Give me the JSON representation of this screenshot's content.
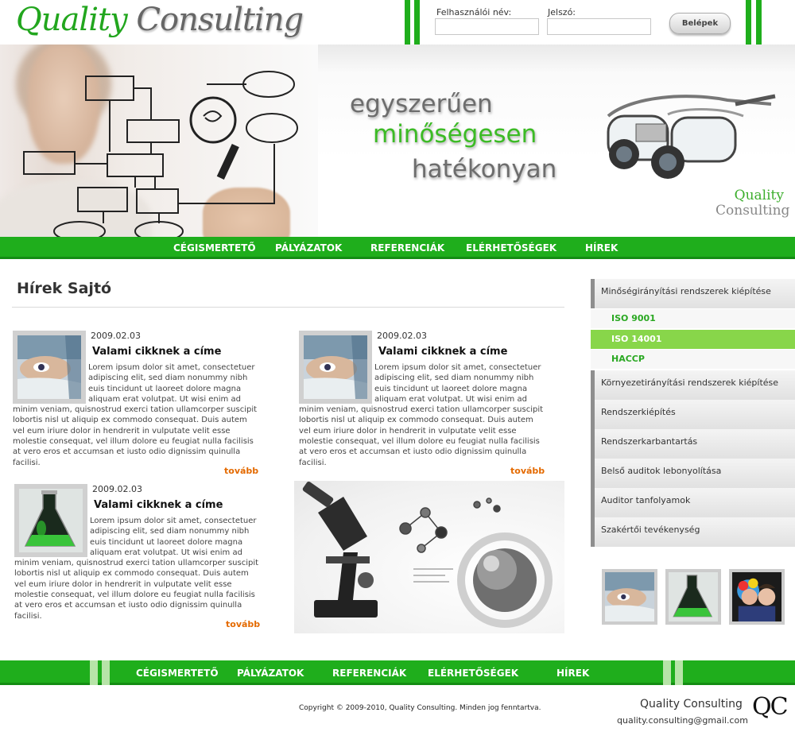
{
  "brand": {
    "word1": "Quality",
    "word2": "Consulting"
  },
  "login": {
    "username_label": "Felhasználói név:",
    "password_label": "Jelszó:",
    "username_value": "",
    "password_value": "",
    "button_label": "Belépek"
  },
  "banner": {
    "slogan_1": "egyszerűen",
    "slogan_2": "minőségesen",
    "slogan_3": "hatékonyan",
    "brand_1": "Quality",
    "brand_2": "Consulting"
  },
  "nav": {
    "items": [
      "CÉGISMERTETŐ",
      "PÁLYÁZATOK",
      "REFERENCIÁK",
      "ELÉRHETŐSÉGEK",
      "HÍREK"
    ]
  },
  "main": {
    "title": "Hírek Sajtó",
    "articles": [
      {
        "date": "2009.02.03",
        "title": "Valami cikknek a címe",
        "body": "Lorem ipsum dolor sit amet, consectetuer adipiscing elit, sed diam nonummy nibh euis tincidunt ut laoreet dolore magna aliquam erat volutpat. Ut wisi enim ad minim veniam, quisnostrud exerci tation ullamcorper suscipit lobortis nisl ut aliquip ex commodo consequat. Duis autem vel eum iriure dolor in hendrerit in vulputate velit esse molestie consequat, vel illum dolore eu feugiat nulla facilisis at vero eros et accumsan et iusto odio dignissim quinulla facilisi.",
        "more": "tovább",
        "image": "surgeon-photo"
      },
      {
        "date": "2009.02.03",
        "title": "Valami cikknek a címe",
        "body": "Lorem ipsum dolor sit amet, consectetuer adipiscing elit, sed diam nonummy nibh euis tincidunt ut laoreet dolore magna aliquam erat volutpat. Ut wisi enim ad minim veniam, quisnostrud exerci tation ullamcorper suscipit lobortis nisl ut aliquip ex commodo consequat. Duis autem vel eum iriure dolor in hendrerit in vulputate velit esse molestie consequat, vel illum dolore eu feugiat nulla facilisis at vero eros et accumsan et iusto odio dignissim quinulla facilisi.",
        "more": "tovább",
        "image": "surgeon-photo"
      },
      {
        "date": "2009.02.03",
        "title": "Valami cikknek a címe",
        "body": "Lorem ipsum dolor sit amet, consectetuer adipiscing elit, sed diam nonummy nibh euis tincidunt ut laoreet dolore magna aliquam erat volutpat. Ut wisi enim ad minim veniam, quisnostrud exerci tation ullamcorper suscipit lobortis nisl ut aliquip ex commodo consequat. Duis autem vel eum iriure dolor in hendrerit in vulputate velit esse molestie consequat, vel illum dolore eu feugiat nulla facilisis at vero eros et accumsan et iusto odio dignissim quinulla facilisi.",
        "more": "tovább",
        "image": "flask-photo"
      }
    ]
  },
  "sidebar": {
    "items": [
      "Minőségirányítási rendszerek kiépítése",
      "Környezetirányítási rendszerek kiépítése",
      "Rendszerkiépítés",
      "Rendszerkarbantartás",
      "Belső auditok lebonyolítása",
      "Auditor tanfolyamok",
      "Szakértői tevékenység"
    ],
    "subitems": [
      "ISO 9001",
      "ISO 14001",
      "HACCP"
    ],
    "active_subitem": "ISO 14001"
  },
  "footer": {
    "copyright": "Copyright © 2009-2010, Quality Consulting. Minden jog fenntartva.",
    "brand": "Quality Consulting",
    "email": "quality.consulting@gmail.com",
    "mark": "QC"
  },
  "colors": {
    "green": "#1fae1c",
    "dark_green": "#148d13",
    "light_green": "#88d64a",
    "orange_link": "#e46a00",
    "gray_text": "#666666"
  }
}
